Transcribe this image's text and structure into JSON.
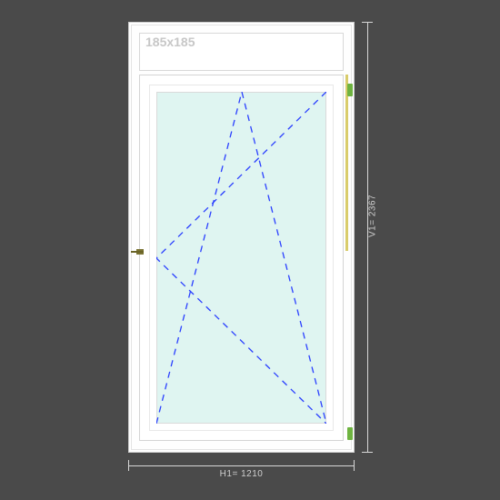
{
  "transom": {
    "size_label": "185x185"
  },
  "dimensions": {
    "horizontal": {
      "label": "H1= 1210",
      "value_mm": 1210
    },
    "vertical": {
      "label": "V1= 2367",
      "value_mm": 2367
    }
  },
  "sash": {
    "opening_type": "tilt-and-turn",
    "hinge_side": "right",
    "opening_marks": "two dashed triangles indicating tilt (bottom-hinged) and turn (side-hinged)"
  },
  "colors": {
    "background": "#4a4a4a",
    "frame": "#ffffff",
    "glass": "#dff5f1",
    "dash_line": "#2a3fff",
    "dim_line": "#cfcfcf",
    "hinge_marker": "#6eb340",
    "handle": "#7a7334"
  }
}
